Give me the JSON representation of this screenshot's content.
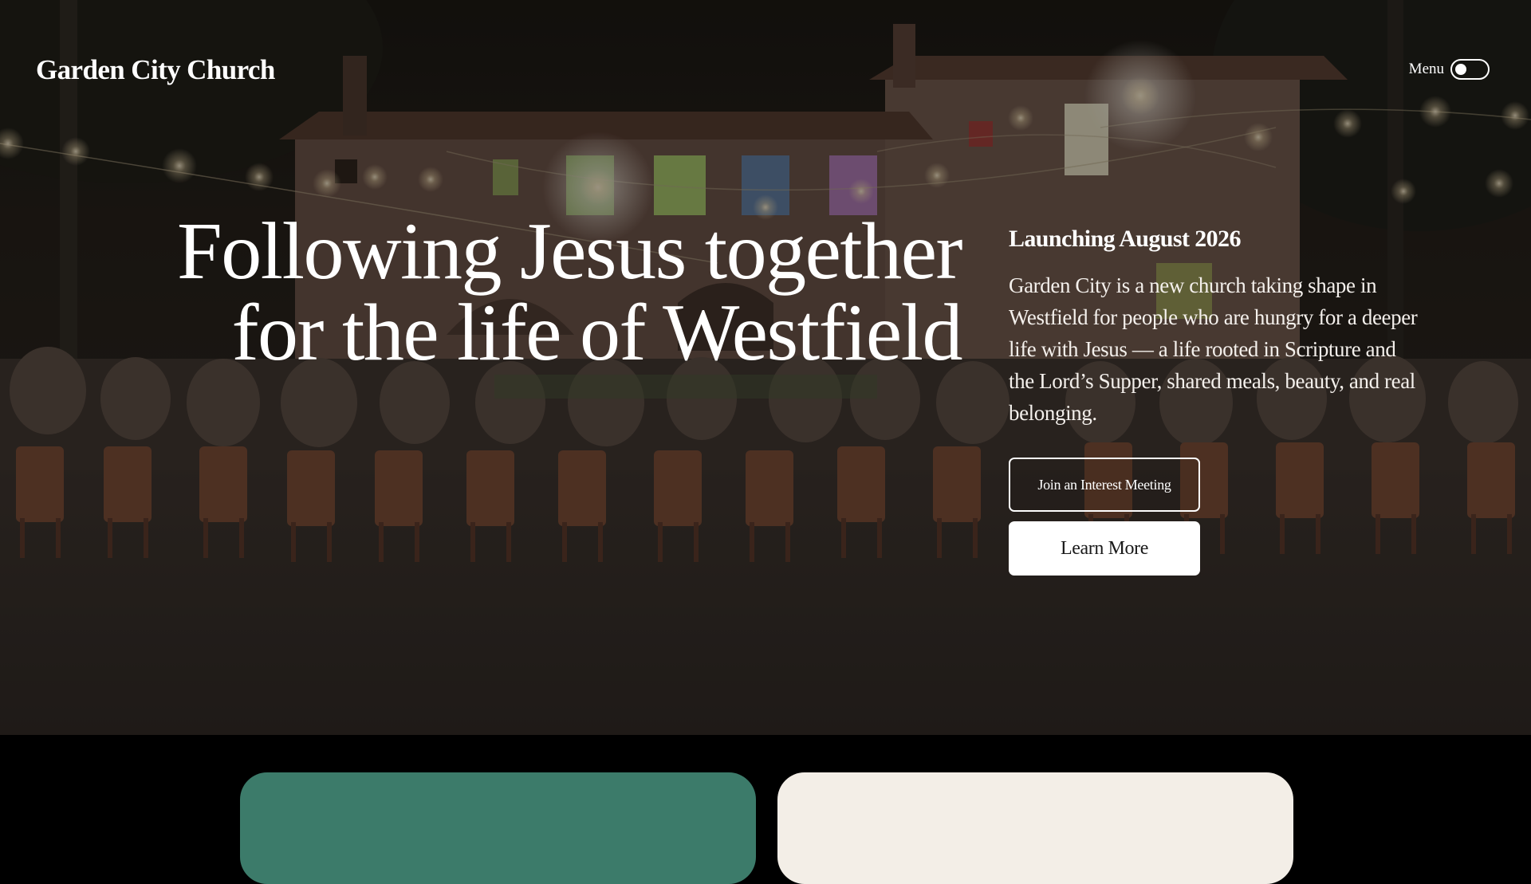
{
  "header": {
    "brand": "Garden City Church",
    "menu_label": "Menu"
  },
  "hero": {
    "headline_line1": "Following Jesus together",
    "headline_line2": "for the life of Westfield",
    "launch": "Launching August 2026",
    "description": "Garden City is a new church taking shape in Westfield for people who are hungry for a deeper life with Jesus — a life rooted in Scripture and the Lord’s Supper, shared meals, beauty, and real belonging.",
    "primary_cta": "Join an Interest Meeting",
    "secondary_cta": "Learn More"
  },
  "cards": {
    "left_color": "#3c7b6a",
    "right_color": "#f3eee7"
  },
  "colors": {
    "page_background": "#000000",
    "text": "#ffffff"
  }
}
